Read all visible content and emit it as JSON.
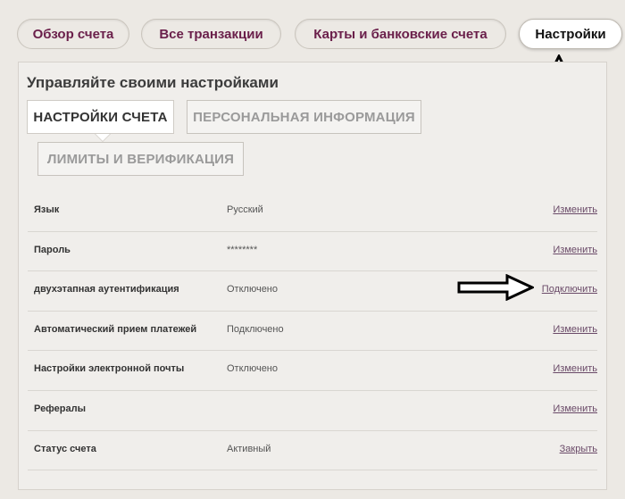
{
  "nav": {
    "tabs": [
      {
        "label": "Обзор счета"
      },
      {
        "label": "Все транзакции"
      },
      {
        "label": "Карты и банковские счета"
      },
      {
        "label": "Настройки"
      }
    ]
  },
  "settings": {
    "heading": "Управляйте своими настройками",
    "tabs": [
      {
        "label": "НАСТРОЙКИ СЧЕТА"
      },
      {
        "label": "ПЕРСОНАЛЬНАЯ ИНФОРМАЦИЯ"
      },
      {
        "label": "ЛИМИТЫ И ВЕРИФИКАЦИЯ"
      }
    ],
    "rows": [
      {
        "label": "Язык",
        "value": "Русский",
        "action": "Изменить"
      },
      {
        "label": "Пароль",
        "value": "********",
        "action": "Изменить"
      },
      {
        "label": "двухэтапная аутентификация",
        "value": "Отключено",
        "action": "Подключить"
      },
      {
        "label": "Автоматический прием платежей",
        "value": "Подключено",
        "action": "Изменить"
      },
      {
        "label": "Настройки электронной почты",
        "value": "Отключено",
        "action": "Изменить"
      },
      {
        "label": "Рефералы",
        "value": "",
        "action": "Изменить"
      },
      {
        "label": "Статус счета",
        "value": "Активный",
        "action": "Закрыть"
      }
    ]
  },
  "colors": {
    "accent": "#6a1f4a",
    "link": "#6a4a68",
    "background": "#ece9e4"
  },
  "annotations": {
    "up_arrow": "arrow-up-icon",
    "right_arrow": "arrow-right-icon"
  }
}
